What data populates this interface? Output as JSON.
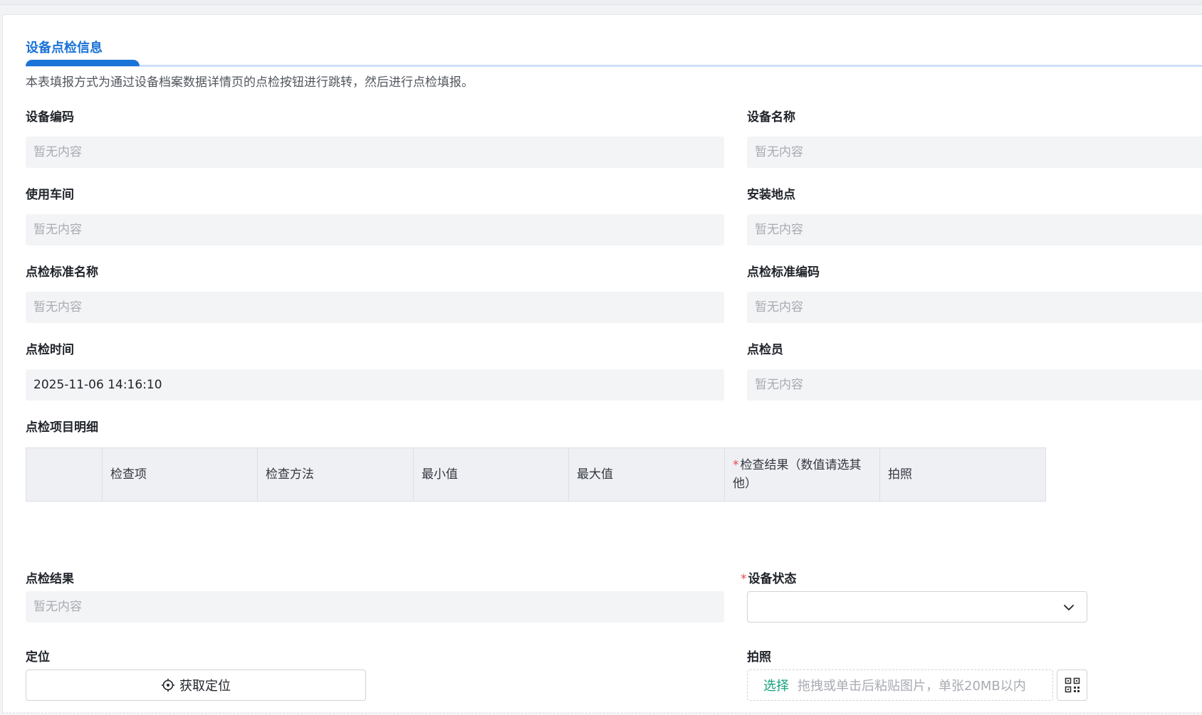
{
  "section": {
    "title": "设备点检信息",
    "description": "本表填报方式为通过设备档案数据详情页的点检按钮进行跳转，然后进行点检填报。"
  },
  "placeholder": "暂无内容",
  "fields": {
    "equipment_code": {
      "label": "设备编码",
      "value": "暂无内容"
    },
    "equipment_name": {
      "label": "设备名称",
      "value": "暂无内容"
    },
    "workshop": {
      "label": "使用车间",
      "value": "暂无内容"
    },
    "install_location": {
      "label": "安装地点",
      "value": "暂无内容"
    },
    "standard_name": {
      "label": "点检标准名称",
      "value": "暂无内容"
    },
    "standard_code": {
      "label": "点检标准编码",
      "value": "暂无内容"
    },
    "inspect_time": {
      "label": "点检时间",
      "value": "2025-11-06 14:16:10"
    },
    "inspector": {
      "label": "点检员",
      "value": "暂无内容"
    },
    "inspect_result": {
      "label": "点检结果",
      "value": "暂无内容"
    },
    "equipment_status": {
      "label": "设备状态",
      "required_mark": "*",
      "value": ""
    },
    "location": {
      "label": "定位",
      "button": "获取定位"
    },
    "photo": {
      "label": "拍照",
      "pick": "选择",
      "hint": "拖拽或单击后粘贴图片，单张20MB以内"
    }
  },
  "detail_table": {
    "label": "点检项目明细",
    "columns": [
      "",
      "检查项",
      "检查方法",
      "最小值",
      "最大值",
      "检查结果（数值请选其他）",
      "拍照"
    ],
    "required_mark": "*"
  },
  "icons": {
    "status_dropdown": "chevron-down-icon",
    "location_button": "crosshair-icon",
    "qr_button": "qr-code-icon"
  },
  "colors": {
    "accent": "#1a73d6",
    "pick": "#16a07a",
    "required": "#e5484d"
  }
}
